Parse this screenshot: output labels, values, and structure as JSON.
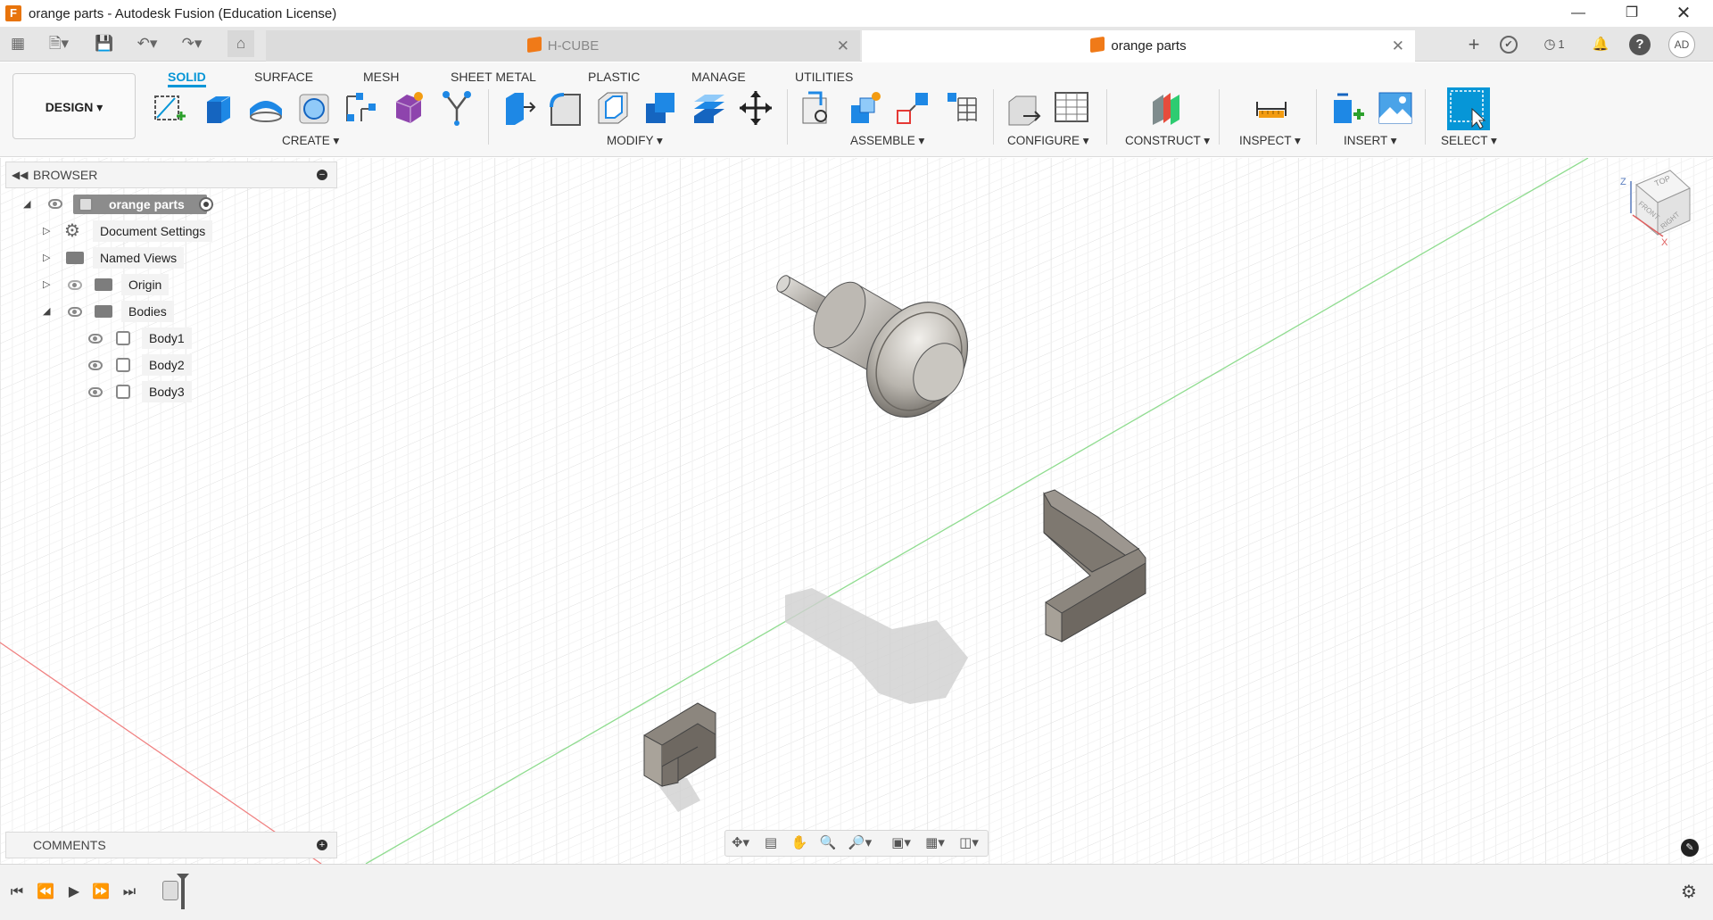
{
  "window": {
    "title": "orange parts - Autodesk Fusion (Education License)",
    "app_logo_letter": "F",
    "controls": [
      "minimize-icon",
      "restore-icon",
      "close-icon"
    ]
  },
  "tabs": [
    {
      "label": "H-CUBE",
      "active": false
    },
    {
      "label": "orange parts",
      "active": true
    }
  ],
  "top_right": {
    "jobs_count": "1",
    "user_initials": "AD"
  },
  "toolbar": {
    "workspace": "DESIGN",
    "ws_tabs": [
      "SOLID",
      "SURFACE",
      "MESH",
      "SHEET METAL",
      "PLASTIC",
      "MANAGE",
      "UTILITIES"
    ],
    "groups": [
      "CREATE",
      "MODIFY",
      "ASSEMBLE",
      "CONFIGURE",
      "CONSTRUCT",
      "INSPECT",
      "INSERT",
      "SELECT"
    ],
    "accent_color": "#0696d7"
  },
  "browser": {
    "title": "BROWSER",
    "root": "orange parts",
    "items": [
      "Document Settings",
      "Named Views",
      "Origin",
      "Bodies"
    ],
    "bodies": [
      "Body1",
      "Body2",
      "Body3"
    ]
  },
  "comments": {
    "title": "COMMENTS"
  },
  "viewcube": {
    "top": "TOP",
    "front": "FRONT",
    "right": "RIGHT",
    "axis_z": "Z",
    "axis_x": "X"
  }
}
